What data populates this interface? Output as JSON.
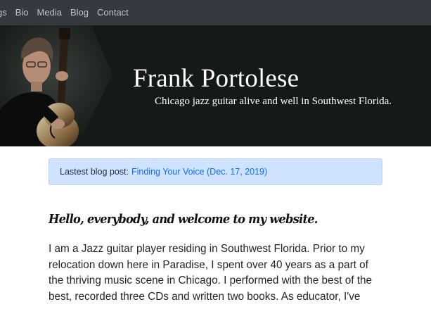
{
  "nav": {
    "items": [
      "gs",
      "Bio",
      "Media",
      "Blog",
      "Contact"
    ]
  },
  "header": {
    "title": "Frank Portolese",
    "tagline": "Chicago jazz guitar alive and well in Southwest Florida."
  },
  "alert": {
    "label": "Lastest blog post:",
    "link_text": "Finding Your Voice (Dec. 17, 2019)"
  },
  "content": {
    "heading": "Hello, everybody, and welcome to my website.",
    "paragraph_lines": [
      "I am a Jazz guitar player residing in Southwest Florida. Prior to my",
      "relocation down here in Paradise, I spent over 40 years as a part of",
      "the thriving music scene in Chicago. I performed with the best of the",
      "best, recorded three CDs and written two books. As educator, I've"
    ]
  },
  "colors": {
    "navbar": "#343a40",
    "banner": "#151a18",
    "alert_bg": "#cfe2ff",
    "link": "#0d6efd"
  }
}
